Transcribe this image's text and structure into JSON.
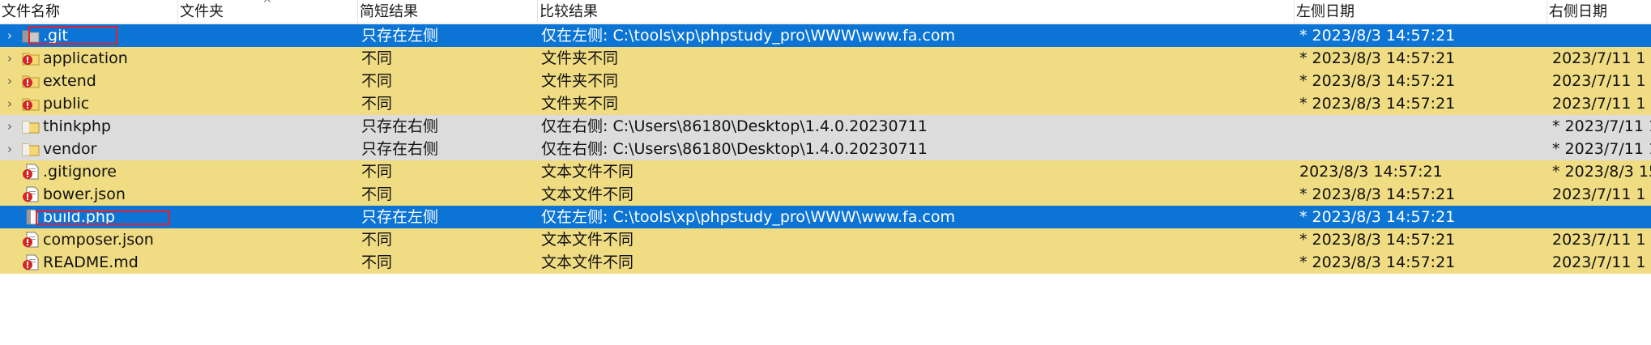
{
  "header": {
    "columns": [
      "文件名称",
      "文件夹",
      "简短结果",
      "比较结果",
      "左侧日期",
      "右侧日期"
    ],
    "sort_indicator": "^"
  },
  "colors": {
    "selected": "#0b74d4",
    "different": "#f0dc82",
    "right_only": "#dcdcdc",
    "highlight_box": "#e5202e"
  },
  "rows": [
    {
      "name": ".git",
      "short": "只存在左侧",
      "result": "仅在左侧: C:\\tools\\xp\\phpstudy_pro\\WWW\\www.fa.com",
      "ldate": "* 2023/8/3 14:57:21",
      "rdate": "",
      "state": "sel",
      "icon": "folder-left-only-icon",
      "expandable": true,
      "boxed": true
    },
    {
      "name": "application",
      "short": "不同",
      "result": "文件夹不同",
      "ldate": "* 2023/8/3 14:57:21",
      "rdate": "2023/7/11 1",
      "state": "diff",
      "icon": "folder-different-icon",
      "expandable": true,
      "boxed": false
    },
    {
      "name": "extend",
      "short": "不同",
      "result": "文件夹不同",
      "ldate": "* 2023/8/3 14:57:21",
      "rdate": "2023/7/11 1",
      "state": "diff",
      "icon": "folder-different-icon",
      "expandable": true,
      "boxed": false
    },
    {
      "name": "public",
      "short": "不同",
      "result": "文件夹不同",
      "ldate": "* 2023/8/3 14:57:21",
      "rdate": "2023/7/11 1",
      "state": "diff",
      "icon": "folder-different-icon",
      "expandable": true,
      "boxed": false
    },
    {
      "name": "thinkphp",
      "short": "只存在右侧",
      "result": "仅在右侧: C:\\Users\\86180\\Desktop\\1.4.0.20230711",
      "ldate": "",
      "rdate": "* 2023/7/11 1",
      "state": "right",
      "icon": "folder-right-only-icon",
      "expandable": true,
      "boxed": false
    },
    {
      "name": "vendor",
      "short": "只存在右侧",
      "result": "仅在右侧: C:\\Users\\86180\\Desktop\\1.4.0.20230711",
      "ldate": "",
      "rdate": "* 2023/7/11 1",
      "state": "right",
      "icon": "folder-right-only-icon",
      "expandable": true,
      "boxed": false
    },
    {
      "name": ".gitignore",
      "short": "不同",
      "result": "文本文件不同",
      "ldate": "2023/8/3 14:57:21",
      "rdate": "* 2023/8/3 15",
      "state": "diff",
      "icon": "file-different-icon",
      "expandable": false,
      "boxed": false
    },
    {
      "name": "bower.json",
      "short": "不同",
      "result": "文本文件不同",
      "ldate": "* 2023/8/3 14:57:21",
      "rdate": "2023/7/11 1",
      "state": "diff",
      "icon": "file-different-icon",
      "expandable": false,
      "boxed": false
    },
    {
      "name": "build.php",
      "short": "只存在左侧",
      "result": "仅在左侧: C:\\tools\\xp\\phpstudy_pro\\WWW\\www.fa.com",
      "ldate": "* 2023/8/3 14:57:21",
      "rdate": "",
      "state": "sel",
      "icon": "file-left-only-icon",
      "expandable": false,
      "boxed": true
    },
    {
      "name": "composer.json",
      "short": "不同",
      "result": "文本文件不同",
      "ldate": "* 2023/8/3 14:57:21",
      "rdate": "2023/7/11 1",
      "state": "diff",
      "icon": "file-different-icon",
      "expandable": false,
      "boxed": false
    },
    {
      "name": "README.md",
      "short": "不同",
      "result": "文本文件不同",
      "ldate": "* 2023/8/3 14:57:21",
      "rdate": "2023/7/11 1",
      "state": "diff",
      "icon": "file-different-icon",
      "expandable": false,
      "boxed": false
    }
  ]
}
